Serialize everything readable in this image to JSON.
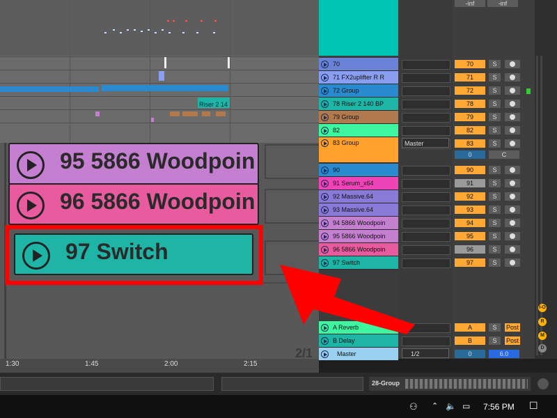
{
  "arrangement": {
    "clips": [
      {
        "label": "Riser 2 14",
        "color": "#1fb5a6"
      }
    ]
  },
  "zoomed_session": {
    "clips": [
      {
        "label": "95 5866 Woodpoin",
        "color": "#c47fd0"
      },
      {
        "label": "96 5866 Woodpoin",
        "color": "#e85c9f"
      },
      {
        "label": "97 Switch",
        "color": "#1fb5a6"
      }
    ],
    "scene_label": "2/1"
  },
  "timeline": {
    "ticks": [
      "1:30",
      "1:45",
      "2:00",
      "2:15"
    ]
  },
  "tracks": [
    {
      "name": "70",
      "color": "#6a82d8",
      "number": "70",
      "num_color": "#ffa833"
    },
    {
      "name": "71 FX2uplifter R R",
      "color": "#8a9ef0",
      "number": "71",
      "num_color": "#ffa833"
    },
    {
      "name": "72 Group",
      "color": "#2a8ad0",
      "number": "72",
      "num_color": "#ffa833"
    },
    {
      "name": "78 Riser 2 140 BP",
      "color": "#1fb5a6",
      "number": "78",
      "num_color": "#ffa833"
    },
    {
      "name": "79 Group",
      "color": "#b07a4e",
      "number": "79",
      "num_color": "#ffa833"
    },
    {
      "name": "82",
      "color": "#3ef5a0",
      "number": "82",
      "num_color": "#ffa833"
    },
    {
      "name": "83 Group",
      "color": "#ffa12a",
      "number": "83",
      "num_color": "#ffa833"
    },
    {
      "name": "90",
      "color": "#2a8ad0",
      "number": "90",
      "num_color": "#ffa833"
    },
    {
      "name": "91 Serum_x64",
      "color": "#ee44b8",
      "number": "91",
      "num_color": "#9a9a9a"
    },
    {
      "name": "92 Massive.64",
      "color": "#8a7ad8",
      "number": "92",
      "num_color": "#ffa833"
    },
    {
      "name": "93 Massive.64",
      "color": "#8a7ad8",
      "number": "93",
      "num_color": "#ffa833"
    },
    {
      "name": "94 5866 Woodpoin",
      "color": "#c47fd0",
      "number": "94",
      "num_color": "#ffa833"
    },
    {
      "name": "95 5866 Woodpoin",
      "color": "#c47fd0",
      "number": "95",
      "num_color": "#ffa833"
    },
    {
      "name": "96 5866 Woodpoin",
      "color": "#e85c9f",
      "number": "96",
      "num_color": "#9a9a9a"
    },
    {
      "name": "97 Switch",
      "color": "#1fb5a6",
      "number": "97",
      "num_color": "#ffa833"
    }
  ],
  "returns": [
    {
      "name": "A Reverb",
      "color": "#3ef5a0",
      "number": "A",
      "post": "Post"
    },
    {
      "name": "B Delay",
      "color": "#1fb5a6",
      "number": "B",
      "post": "Post"
    }
  ],
  "master": {
    "name": "Master",
    "color": "#9ad0f0",
    "routing": "1/2",
    "volume": "0",
    "value2": "6.0"
  },
  "group83": {
    "output": "Master",
    "value": "0",
    "pan": "C"
  },
  "mixer": {
    "inf_left": "-inf",
    "inf_right": "-inf",
    "solo": "S"
  },
  "io_buttons": [
    "I-O",
    "R",
    "M",
    "D"
  ],
  "statusbar": {
    "label": "28-Group"
  },
  "taskbar": {
    "time": "7:56 PM"
  }
}
